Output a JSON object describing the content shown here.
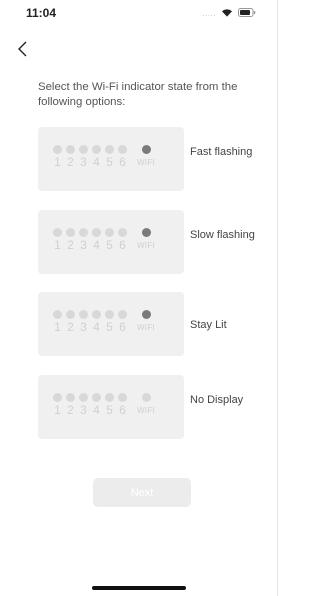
{
  "status_bar": {
    "time": "11:04",
    "signal_dots": "....."
  },
  "instruction": "Select the Wi-Fi indicator state from the following options:",
  "options": [
    {
      "label": "Fast flashing",
      "led_numbers": [
        "1",
        "2",
        "3",
        "4",
        "5",
        "6"
      ],
      "wifi_label": "WIFI",
      "wifi_led_on": true
    },
    {
      "label": "Slow flashing",
      "led_numbers": [
        "1",
        "2",
        "3",
        "4",
        "5",
        "6"
      ],
      "wifi_label": "WIFI",
      "wifi_led_on": true
    },
    {
      "label": "Stay Lit",
      "led_numbers": [
        "1",
        "2",
        "3",
        "4",
        "5",
        "6"
      ],
      "wifi_label": "WIFI",
      "wifi_led_on": true
    },
    {
      "label": "No Display",
      "led_numbers": [
        "1",
        "2",
        "3",
        "4",
        "5",
        "6"
      ],
      "wifi_label": "WIFI",
      "wifi_led_on": false
    }
  ],
  "next_button": {
    "label": "Next"
  },
  "colors": {
    "card_bg": "#f0f0f0",
    "led_off": "#d8d8d8",
    "led_on": "#7a7a7a",
    "button_disabled": "#ececec"
  }
}
